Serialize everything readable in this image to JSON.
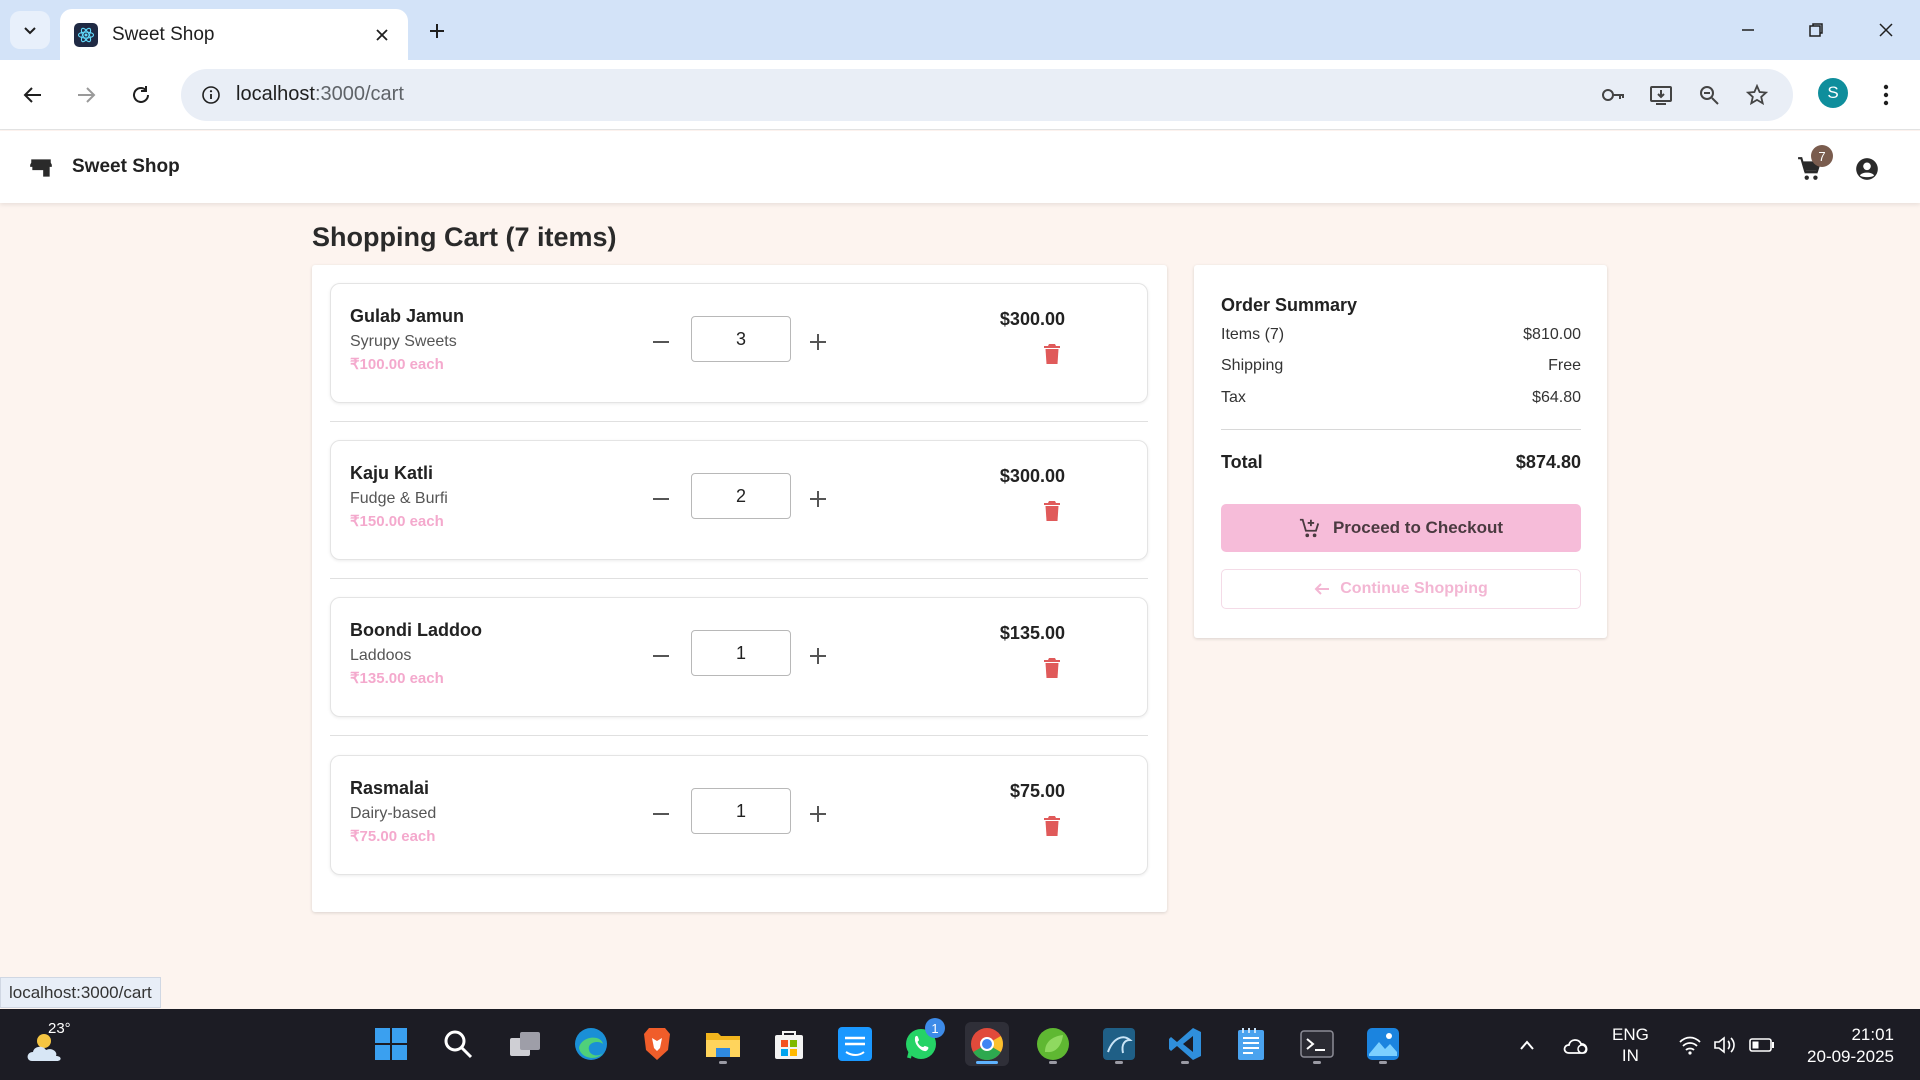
{
  "browser": {
    "tab_title": "Sweet Shop",
    "url_host": "localhost",
    "url_path": ":3000/cart",
    "profile_initial": "S"
  },
  "app": {
    "brand": "Sweet Shop",
    "cart_count": "7"
  },
  "cart": {
    "title": "Shopping Cart (7 items)",
    "items": [
      {
        "name": "Gulab Jamun",
        "category": "Syrupy Sweets",
        "unit_price": "₹100.00 each",
        "quantity": "3",
        "total": "$300.00"
      },
      {
        "name": "Kaju Katli",
        "category": "Fudge & Burfi",
        "unit_price": "₹150.00 each",
        "quantity": "2",
        "total": "$300.00"
      },
      {
        "name": "Boondi Laddoo",
        "category": "Laddoos",
        "unit_price": "₹135.00 each",
        "quantity": "1",
        "total": "$135.00"
      },
      {
        "name": "Rasmalai",
        "category": "Dairy-based",
        "unit_price": "₹75.00 each",
        "quantity": "1",
        "total": "$75.00"
      }
    ]
  },
  "summary": {
    "title": "Order Summary",
    "items_label": "Items (7)",
    "items_value": "$810.00",
    "shipping_label": "Shipping",
    "shipping_value": "Free",
    "tax_label": "Tax",
    "tax_value": "$64.80",
    "total_label": "Total",
    "total_value": "$874.80",
    "checkout_label": "Proceed to Checkout",
    "continue_label": "Continue Shopping"
  },
  "status_url": "localhost:3000/cart",
  "taskbar": {
    "temperature": "23°",
    "whatsapp_badge": "1",
    "lang_line1": "ENG",
    "lang_line2": "IN",
    "time": "21:01",
    "date": "20-09-2025"
  },
  "colors": {
    "accent_pink": "#f6bcd9",
    "delete_red": "#e05a5a",
    "page_bg": "#fdf4ef"
  }
}
